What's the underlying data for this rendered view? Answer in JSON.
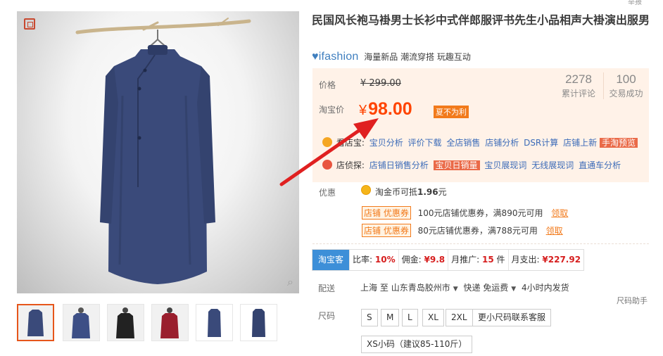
{
  "product": {
    "title": "民国风长袍马褂男士长衫中式伴郎服评书先生小品相声大褂演出服男",
    "top_hint": "举报"
  },
  "brand": {
    "logo_text": "ifashion",
    "slogan": "海量新品 潮流穿搭 玩趣互动"
  },
  "price": {
    "label": "价格",
    "original": "¥ 299.00",
    "taobao_label": "淘宝价",
    "currency": "¥",
    "current": "98.00",
    "promo_badge": "夏不为利"
  },
  "stats": [
    {
      "value": "2278",
      "label": "累计评论"
    },
    {
      "value": "100",
      "label": "交易成功"
    }
  ],
  "tools": {
    "row1": {
      "name": "看店宝:",
      "links": [
        "宝贝分析",
        "评价下载",
        "全店销售",
        "店铺分析",
        "DSR计算",
        "店铺上新"
      ],
      "highlight": "手淘预览"
    },
    "row2": {
      "name": "店侦探:",
      "links": [
        "店铺日销售分析"
      ],
      "highlight": "宝贝日销量",
      "links_after": [
        "宝贝展现词",
        "无线展现词",
        "直通车分析"
      ]
    }
  },
  "coupons": {
    "label": "优惠",
    "coin_text": "淘金币可抵",
    "coin_amount": "1.96",
    "coin_unit": "元",
    "items": [
      {
        "tag": "店铺 优惠券",
        "text": "100元店铺优惠券，满890元可用",
        "link": "领取"
      },
      {
        "tag": "店铺 优惠券",
        "text": "80元店铺优惠券，满788元可用",
        "link": "领取"
      }
    ]
  },
  "taoke": {
    "title": "淘宝客",
    "rate_label": "比率:",
    "rate": "10%",
    "commission_label": "佣金:",
    "commission": "¥9.8",
    "monthly_promo_label": "月推广:",
    "monthly_promo": "15",
    "monthly_promo_unit": "件",
    "monthly_spend_label": "月支出:",
    "monthly_spend": "¥227.92"
  },
  "shipping": {
    "label": "配送",
    "from": "上海",
    "to_word": "至",
    "to": "山东青岛胶州市",
    "method": "快递 免运费",
    "delivery": "4小时内发货"
  },
  "size": {
    "label": "尺码",
    "helper": "尺码助手",
    "options": [
      "S",
      "M",
      "L",
      "XL",
      "2XL",
      "更小尺码联系客服",
      "XS小码（建议85-110斤）"
    ]
  },
  "colors": {
    "accent": "#ff4400",
    "promo_orange": "#f27a1b",
    "price_panel_bg": "#fff2e8",
    "link_blue": "#3b6bb8",
    "taoke_blue": "#3d8fd8",
    "robe_navy": "#3a4a7a",
    "arrow_red": "#e02020"
  },
  "icons": {
    "zoom": "magnifier-icon",
    "stamp": "seal-icon",
    "coin": "gold-coin-icon",
    "dropdown": "caret-down-icon"
  }
}
